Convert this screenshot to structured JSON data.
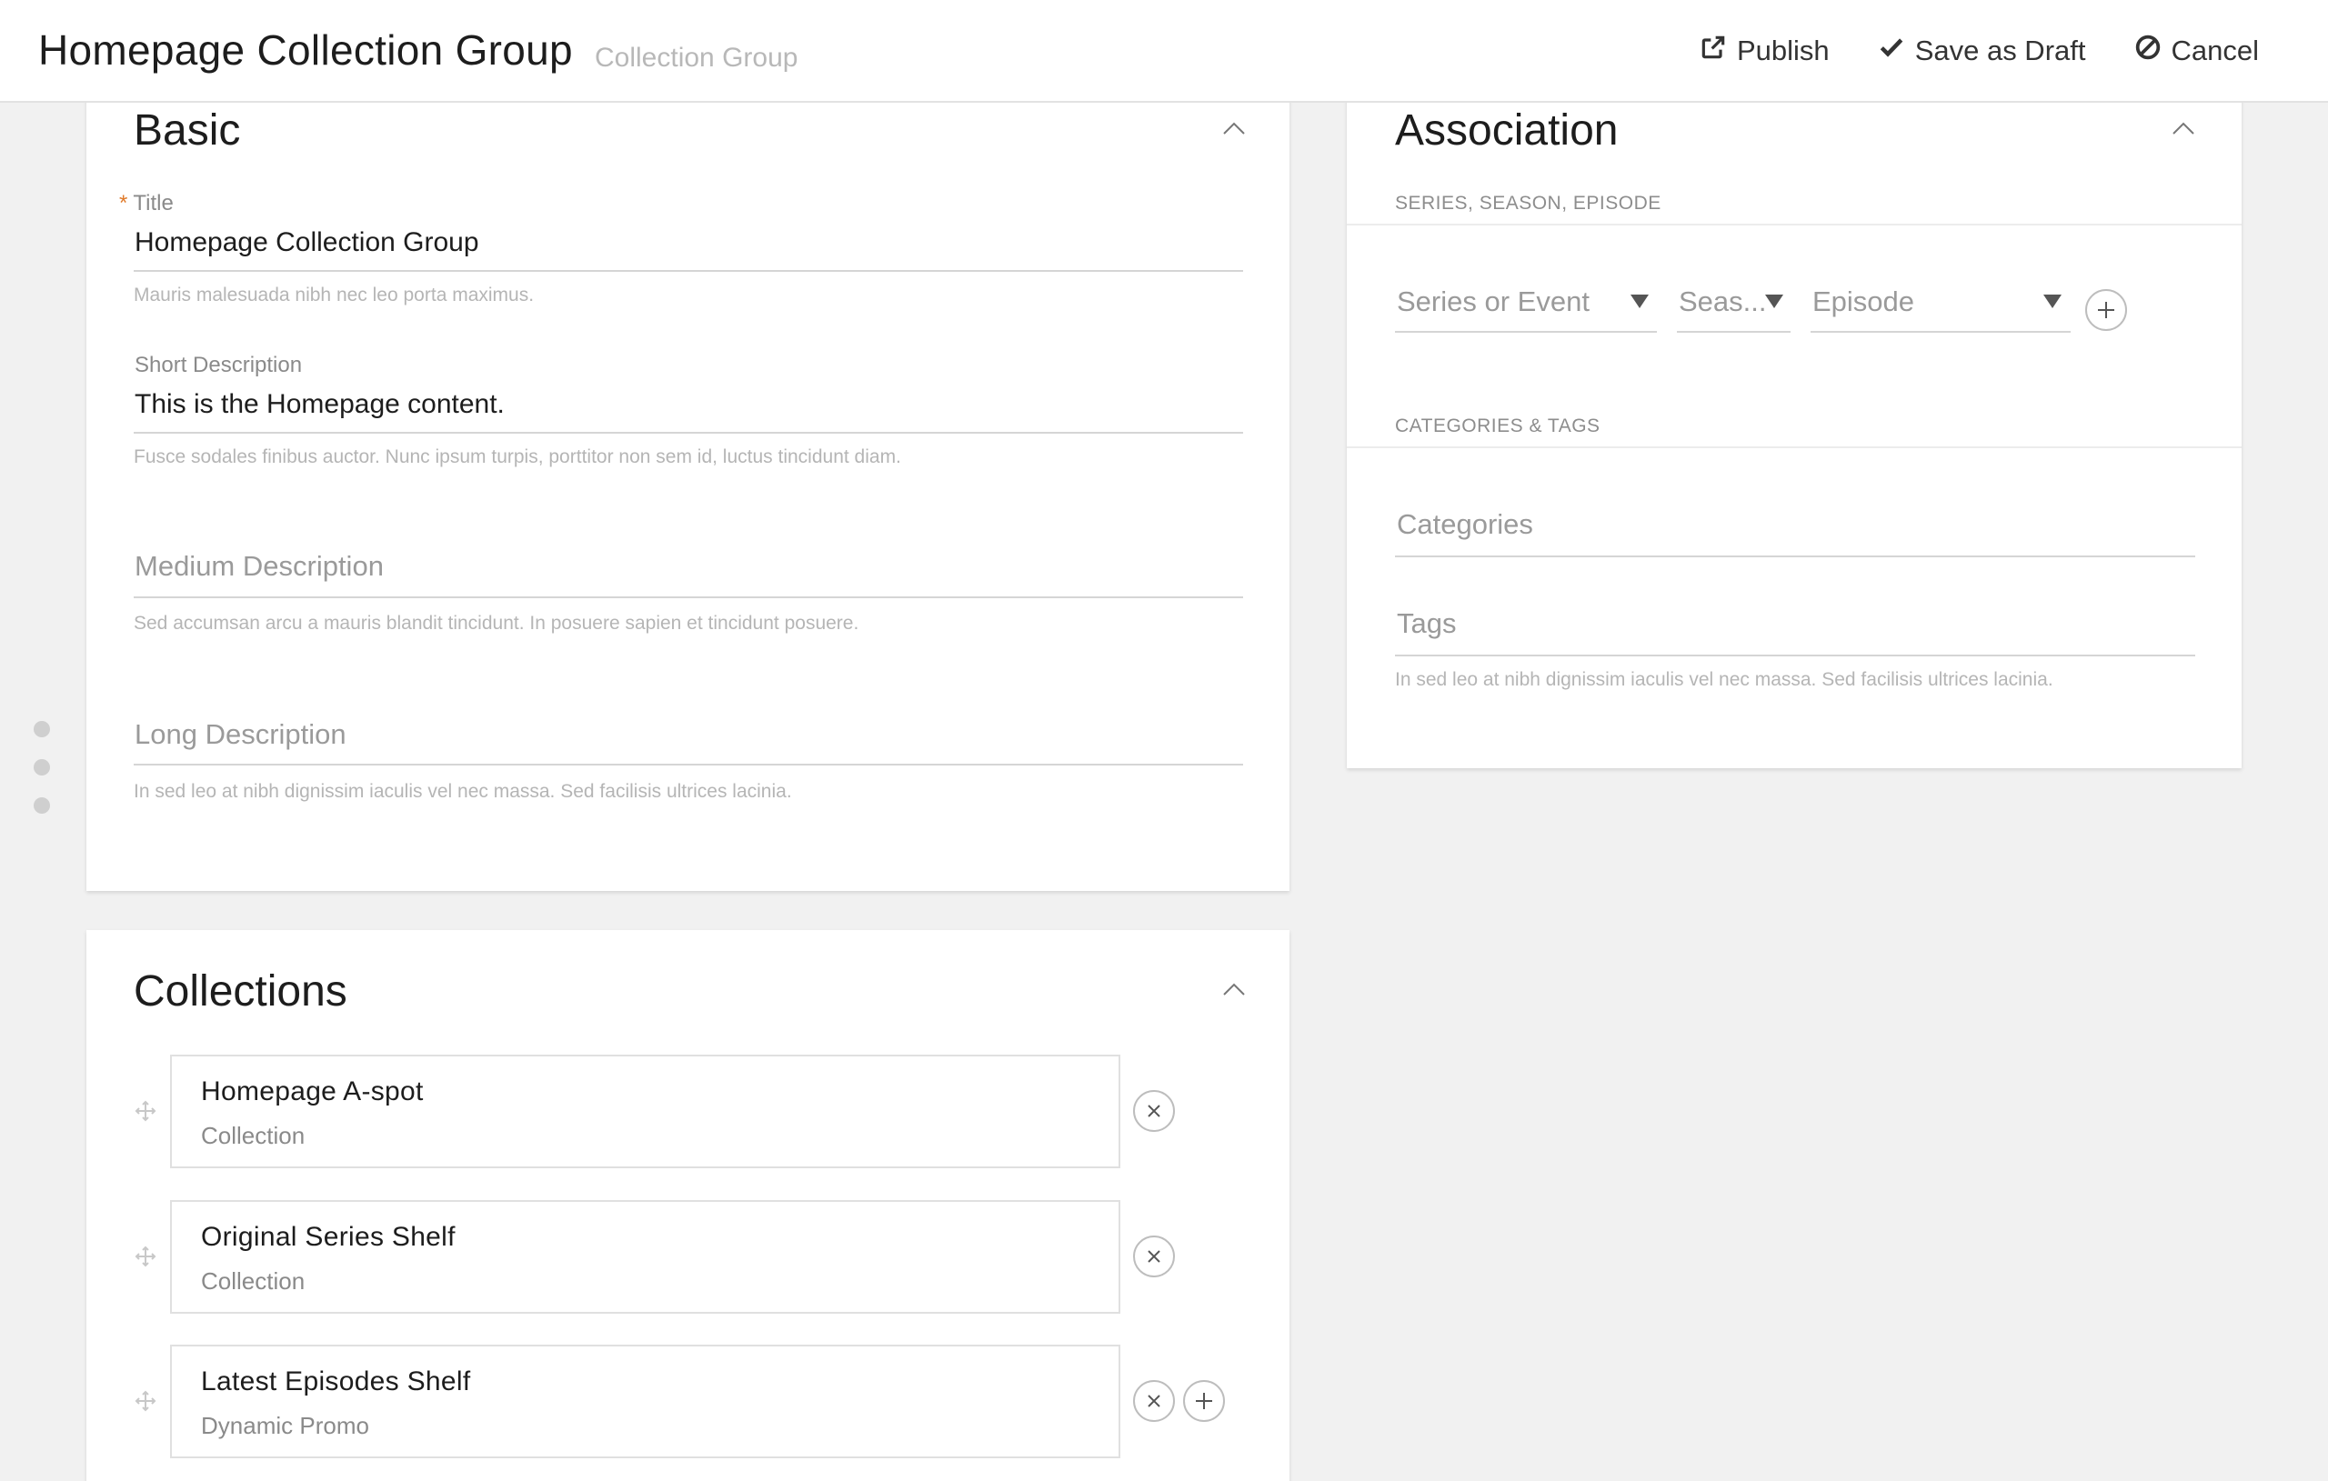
{
  "header": {
    "title": "Homepage Collection Group",
    "subtitle": "Collection Group",
    "actions": {
      "publish": "Publish",
      "save_draft": "Save as Draft",
      "cancel": "Cancel"
    }
  },
  "basic": {
    "title": "Basic",
    "fields": {
      "title": {
        "label": "Title",
        "required_marker": "*",
        "value": "Homepage Collection Group",
        "help": "Mauris malesuada nibh nec leo porta maximus."
      },
      "short_description": {
        "label": "Short Description",
        "value": "This is the Homepage content.",
        "help": "Fusce sodales finibus auctor. Nunc ipsum turpis, porttitor non sem id, luctus tincidunt diam."
      },
      "medium_description": {
        "placeholder": "Medium Description",
        "help": "Sed accumsan arcu a mauris blandit tincidunt. In posuere sapien et tincidunt posuere."
      },
      "long_description": {
        "placeholder": "Long Description",
        "help": "In sed leo at nibh dignissim iaculis vel nec massa. Sed facilisis ultrices lacinia."
      }
    }
  },
  "association": {
    "title": "Association",
    "series_section_label": "SERIES, SEASON, EPISODE",
    "selects": {
      "series": "Series or Event",
      "season": "Seas...",
      "episode": "Episode"
    },
    "categories_section_label": "CATEGORIES & TAGS",
    "categories_placeholder": "Categories",
    "tags_placeholder": "Tags",
    "tags_help": "In sed leo at nibh dignissim iaculis vel nec massa. Sed facilisis ultrices lacinia."
  },
  "collections": {
    "title": "Collections",
    "items": [
      {
        "name": "Homepage A-spot",
        "type": "Collection"
      },
      {
        "name": "Original Series Shelf",
        "type": "Collection"
      },
      {
        "name": "Latest Episodes Shelf",
        "type": "Dynamic Promo"
      }
    ]
  },
  "icons": {
    "publish": "external-link-icon",
    "save_draft": "checkmark-icon",
    "cancel": "ban-icon",
    "collapse": "chevron-up-icon",
    "remove": "close-icon",
    "add": "plus-icon",
    "drag": "move-icon"
  },
  "colors": {
    "required": "#e07a2a",
    "background": "#f1f1f1"
  }
}
